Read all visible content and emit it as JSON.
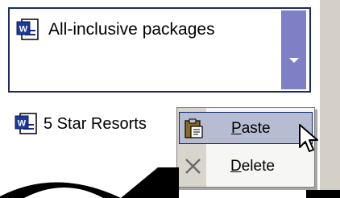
{
  "task_pane": {
    "items": [
      {
        "label": "All-inclusive packages",
        "icon": "word-document-icon",
        "selected": true
      },
      {
        "label": "5 Star Resorts",
        "icon": "word-document-icon",
        "selected": false
      }
    ]
  },
  "context_menu": {
    "items": [
      {
        "label_accel": "P",
        "label_rest": "aste",
        "icon": "paste-icon",
        "hovered": true
      },
      {
        "label_accel": "D",
        "label_rest": "elete",
        "icon": "delete-x-icon",
        "hovered": false
      }
    ]
  },
  "colors": {
    "selection_border": "#1b2a6b",
    "dropdown_button": "#7f7fc6",
    "menu_hover": "#b6bdd2",
    "menu_icon_column": "#d8d5cc",
    "side_strip": "#d4d0c8"
  }
}
